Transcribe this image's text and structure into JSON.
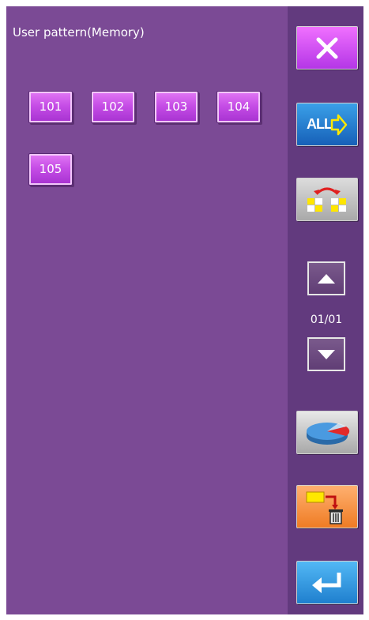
{
  "header": {
    "title": "User pattern(Memory)"
  },
  "patterns": [
    "101",
    "102",
    "103",
    "104",
    "105"
  ],
  "sidebar": {
    "all_label": "ALL",
    "page_indicator": "01/01"
  },
  "colors": {
    "main_panel": "#7b4a95",
    "side_panel": "#623a7e",
    "pattern_button": "#c64ee6"
  }
}
